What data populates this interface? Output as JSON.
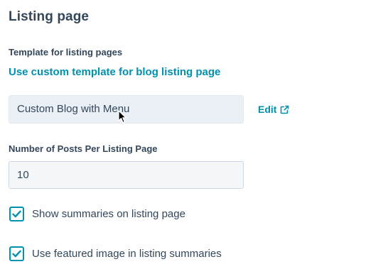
{
  "section": {
    "title": "Listing page"
  },
  "template": {
    "label": "Template for listing pages",
    "custom_link": "Use custom template for blog listing page",
    "selected_value": "Custom Blog with Menu",
    "edit_label": "Edit",
    "edit_icon": "external-link-icon"
  },
  "posts_per_page": {
    "label": "Number of Posts Per Listing Page",
    "value": "10"
  },
  "options": [
    {
      "label": "Show summaries on listing page",
      "checked": true
    },
    {
      "label": "Use featured image in listing summaries",
      "checked": true
    }
  ],
  "colors": {
    "accent": "#0091ae",
    "text": "#33475b",
    "select_bg": "#eaf0f6",
    "input_bg": "#f5f8fa",
    "input_border": "#cbd6e2"
  }
}
